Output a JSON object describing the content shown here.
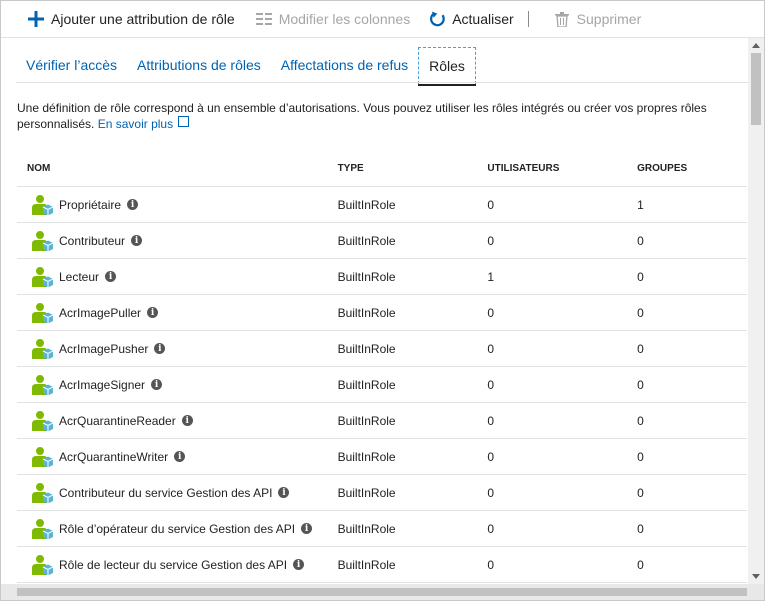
{
  "toolbar": {
    "add_label": "Ajouter une attribution de rôle",
    "columns_label": "Modifier les colonnes",
    "refresh_label": "Actualiser",
    "delete_label": "Supprimer",
    "accent_color": "#0063b1"
  },
  "tabs": [
    {
      "label": "Vérifier l’accès"
    },
    {
      "label": "Attributions de rôles"
    },
    {
      "label": "Affectations de refus"
    },
    {
      "label": "Rôles"
    }
  ],
  "description": {
    "text": "Une définition de rôle correspond à un ensemble d’autorisations. Vous pouvez utiliser les rôles intégrés ou créer vos propres rôles personnalisés.",
    "link": "En savoir plus"
  },
  "table": {
    "headers": {
      "name": "NOM",
      "type": "TYPE",
      "users": "UTILISATEURS",
      "groups": "GROUPES"
    },
    "rows": [
      {
        "name": "Propriétaire",
        "type": "BuiltInRole",
        "users": "0",
        "groups": "1"
      },
      {
        "name": "Contributeur",
        "type": "BuiltInRole",
        "users": "0",
        "groups": "0"
      },
      {
        "name": "Lecteur",
        "type": "BuiltInRole",
        "users": "1",
        "groups": "0"
      },
      {
        "name": "AcrImagePuller",
        "type": "BuiltInRole",
        "users": "0",
        "groups": "0"
      },
      {
        "name": "AcrImagePusher",
        "type": "BuiltInRole",
        "users": "0",
        "groups": "0"
      },
      {
        "name": "AcrImageSigner",
        "type": "BuiltInRole",
        "users": "0",
        "groups": "0"
      },
      {
        "name": "AcrQuarantineReader",
        "type": "BuiltInRole",
        "users": "0",
        "groups": "0"
      },
      {
        "name": "AcrQuarantineWriter",
        "type": "BuiltInRole",
        "users": "0",
        "groups": "0"
      },
      {
        "name": "Contributeur du service Gestion des API",
        "type": "BuiltInRole",
        "users": "0",
        "groups": "0"
      },
      {
        "name": "Rôle d’opérateur du service Gestion des API",
        "type": "BuiltInRole",
        "users": "0",
        "groups": "0"
      },
      {
        "name": "Rôle de lecteur du service Gestion des API",
        "type": "BuiltInRole",
        "users": "0",
        "groups": "0"
      }
    ]
  }
}
